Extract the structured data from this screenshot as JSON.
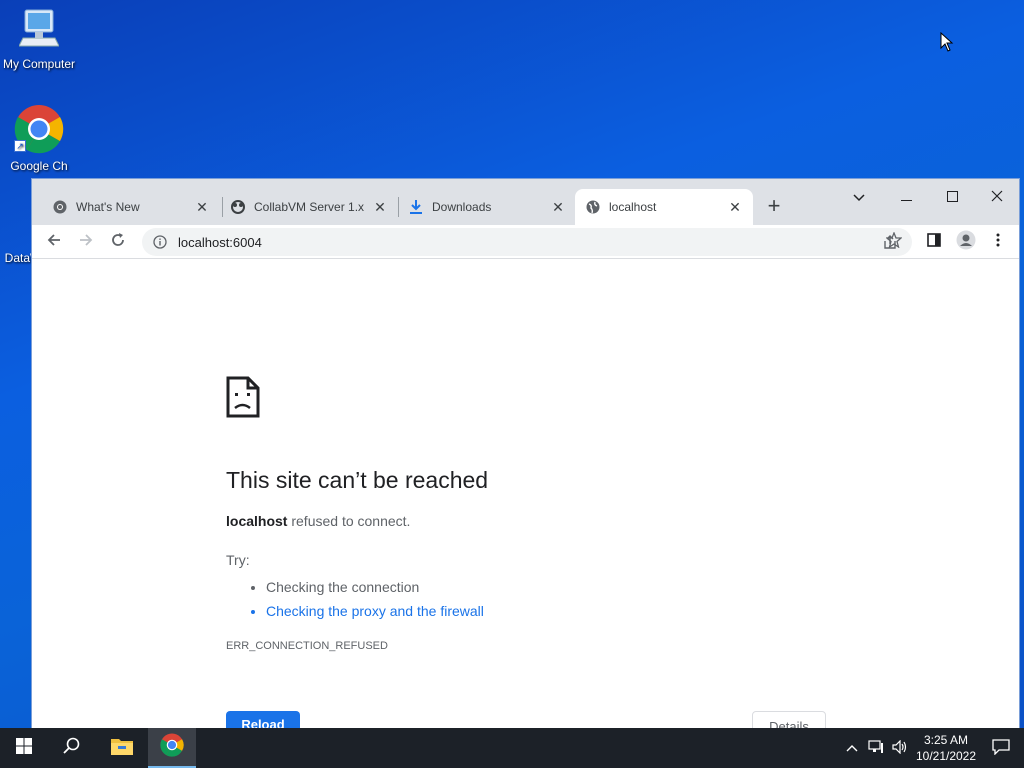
{
  "desktop": {
    "icons": [
      {
        "label": "My Computer"
      },
      {
        "label": "Google Ch"
      },
      {
        "label": "DataW"
      }
    ]
  },
  "browser": {
    "tabs": [
      {
        "title": "What's New",
        "icon": "chrome-icon"
      },
      {
        "title": "CollabVM Server 1.x",
        "icon": "collabvm-icon"
      },
      {
        "title": "Downloads",
        "icon": "download-icon"
      },
      {
        "title": "localhost",
        "icon": "globe-icon",
        "active": true
      }
    ],
    "address": "localhost:6004"
  },
  "page": {
    "title": "This site can’t be reached",
    "host": "localhost",
    "desc_rest": " refused to connect.",
    "try_label": "Try:",
    "suggestions": [
      "Checking the connection",
      "Checking the proxy and the firewall"
    ],
    "error_code": "ERR_CONNECTION_REFUSED",
    "reload_label": "Reload",
    "details_label": "Details"
  },
  "taskbar": {
    "time": "3:25 AM",
    "date": "10/21/2022"
  },
  "colors": {
    "accent": "#1a73e8",
    "desktop": "#0b5fe0",
    "taskbar": "#1c2128"
  }
}
